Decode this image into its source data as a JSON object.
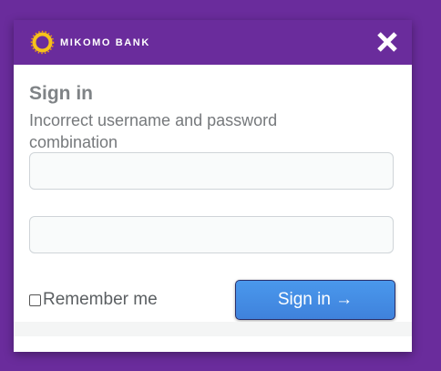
{
  "brand": {
    "name": "MIKOMO BANK",
    "logo_colors": [
      "#f6c21a",
      "#f39c12"
    ]
  },
  "header": {
    "close_icon": "close-icon",
    "background": "#6a2c9c"
  },
  "form": {
    "title": "Sign in",
    "error_message": "Incorrect username and password combination",
    "username": {
      "value": "",
      "placeholder": ""
    },
    "password": {
      "value": "",
      "placeholder": ""
    },
    "remember_label": "Remember me",
    "remember_checked": false,
    "submit_label": "Sign in →",
    "submit_color": "#4a98ec"
  }
}
